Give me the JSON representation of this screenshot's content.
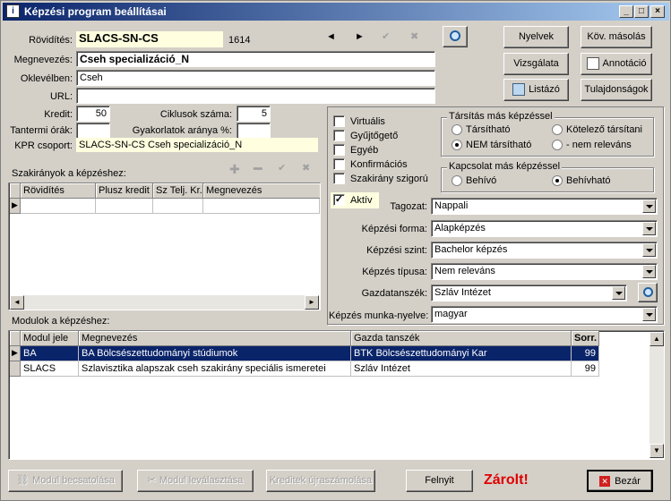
{
  "window": {
    "title": "Képzési program beállításai"
  },
  "header": {
    "rovidites_label": "Rövidítés:",
    "rovidites_value": "SLACS-SN-CS",
    "id_value": "1614",
    "megnevezes_label": "Megnevezés:",
    "megnevezes_value": "Cseh specializáció_N",
    "oklevelben_label": "Oklevélben:",
    "oklevelben_value": "Cseh",
    "url_label": "URL:",
    "url_value": "",
    "kredit_label": "Kredit:",
    "kredit_value": "50",
    "ciklusok_label": "Ciklusok száma:",
    "ciklusok_value": "5",
    "tantermi_label": "Tantermi órák:",
    "tantermi_value": "",
    "gyakorlatok_label": "Gyakorlatok aránya %:",
    "gyakorlatok_value": "",
    "kpr_label": "KPR csoport:",
    "kpr_value": "SLACS-SN-CS Cseh specializáció_N"
  },
  "right_buttons": {
    "nyelvek": "Nyelvek",
    "kov_masolas": "Köv. másolás",
    "vizsgalata": "Vizsgálata",
    "annotacio": "Annotáció",
    "listazo": "Listázó",
    "tulajdonsagok": "Tulajdonságok"
  },
  "checkboxes": [
    {
      "label": "Virtuális",
      "checked": false
    },
    {
      "label": "Gyűjtőgető",
      "checked": false
    },
    {
      "label": "Egyéb",
      "checked": false
    },
    {
      "label": "Konfirmációs",
      "checked": false
    },
    {
      "label": "Szakirány szigorú",
      "checked": false
    }
  ],
  "aktiv": {
    "label": "Aktív",
    "checked": true
  },
  "tarsitas": {
    "title": "Társítás más képzéssel",
    "opt1": "Társítható",
    "opt2": "Kötelező társítani",
    "opt3": "NEM társítható",
    "opt4": "- nem releváns",
    "selected": "NEM társítható"
  },
  "kapcsolat": {
    "title": "Kapcsolat más képzéssel",
    "opt1": "Behívó",
    "opt2": "Behívható",
    "selected": "Behívható"
  },
  "selects": {
    "tagozat_label": "Tagozat:",
    "tagozat_value": "Nappali",
    "forma_label": "Képzési forma:",
    "forma_value": "Alapképzés",
    "szint_label": "Képzési szint:",
    "szint_value": "Bachelor képzés",
    "tipusa_label": "Képzés típusa:",
    "tipusa_value": "Nem releváns",
    "gazda_label": "Gazdatanszék:",
    "gazda_value": "Szláv Intézet",
    "nyelve_label": "Képzés munka-nyelve:",
    "nyelve_value": "magyar"
  },
  "szakiranyok": {
    "title": "Szakirányok a képzéshez:",
    "columns": [
      "Rövidítés",
      "Plusz kredit",
      "Sz Telj. Kr.",
      "Megnevezés"
    ]
  },
  "modulok": {
    "title": "Modulok a képzéshez:",
    "columns": [
      "Modul jele",
      "Megnevezés",
      "Gazda tanszék",
      "Sorr."
    ],
    "rows": [
      [
        "BA",
        "BA Bölcsészettudományi stúdiumok",
        "BTK Bölcsészettudományi Kar",
        "99"
      ],
      [
        "SLACS",
        "Szlavisztika alapszak cseh szakirány speciális ismeretei",
        "Szláv Intézet",
        "99"
      ]
    ]
  },
  "bottom": {
    "modul_becsatolasa": "Modul becsatolása",
    "modul_levalasztasa": "Modul leválasztása",
    "kreditek": "Kreditek újraszámolása",
    "felnyit": "Felnyit",
    "zarolt": "Zárolt!",
    "bezar": "Bezár"
  },
  "colors": {
    "accent": "#0a246a",
    "locked": "#e00000",
    "highlight": "#ffffe0"
  }
}
